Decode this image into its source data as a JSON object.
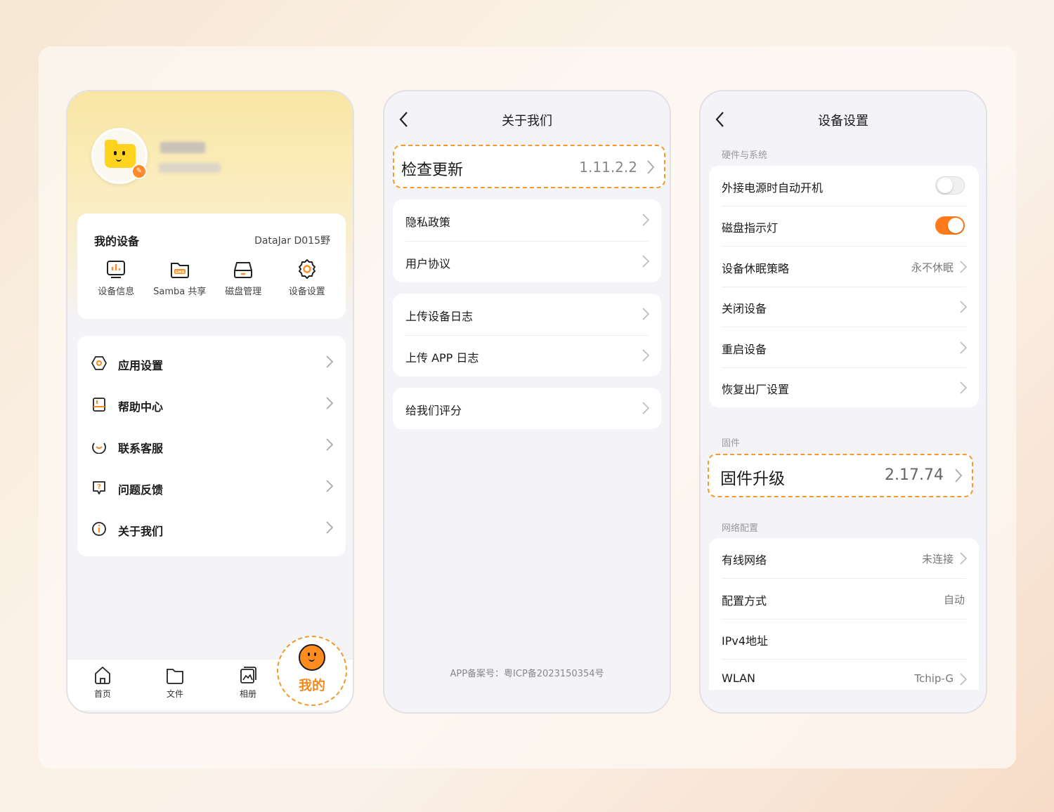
{
  "colors": {
    "accent": "#ff7a1a",
    "highlight_border": "#f39a2b",
    "background": "#fbf1e6"
  },
  "phone1": {
    "device_panel": {
      "title": "我的设备",
      "device_name": "DataJar D015野",
      "tools": [
        {
          "label": "设备信息",
          "icon": "chart-icon"
        },
        {
          "label": "Samba 共享",
          "icon": "smb-folder-icon"
        },
        {
          "label": "磁盘管理",
          "icon": "disk-icon"
        },
        {
          "label": "设备设置",
          "icon": "gear-icon"
        }
      ]
    },
    "menu": [
      {
        "label": "应用设置",
        "icon": "app-settings-icon"
      },
      {
        "label": "帮助中心",
        "icon": "help-book-icon"
      },
      {
        "label": "联系客服",
        "icon": "customer-service-icon"
      },
      {
        "label": "问题反馈",
        "icon": "feedback-icon"
      },
      {
        "label": "关于我们",
        "icon": "info-icon"
      }
    ],
    "tabs": [
      {
        "label": "首页",
        "icon": "home-icon"
      },
      {
        "label": "文件",
        "icon": "file-icon"
      },
      {
        "label": "相册",
        "icon": "album-icon"
      },
      {
        "label": "我的",
        "icon": "me-face-icon"
      }
    ]
  },
  "phone2": {
    "title": "关于我们",
    "check_update": {
      "label": "检查更新",
      "version": "1.11.2.2"
    },
    "group1": [
      {
        "label": "隐私政策"
      },
      {
        "label": "用户协议"
      }
    ],
    "group2": [
      {
        "label": "上传设备日志"
      },
      {
        "label": "上传 APP 日志"
      }
    ],
    "group3": [
      {
        "label": "给我们评分"
      }
    ],
    "footer": "APP备案号：粤ICP备2023150354号"
  },
  "phone3": {
    "title": "设备设置",
    "section_hw": "硬件与系统",
    "hw_rows": [
      {
        "label": "外接电源时自动开机",
        "toggle": "off"
      },
      {
        "label": "磁盘指示灯",
        "toggle": "on"
      },
      {
        "label": "设备休眠策略",
        "value": "永不休眠"
      },
      {
        "label": "关闭设备"
      },
      {
        "label": "重启设备"
      },
      {
        "label": "恢复出厂设置"
      }
    ],
    "section_fw": "固件",
    "firmware": {
      "label": "固件升级",
      "version": "2.17.74"
    },
    "section_net": "网络配置",
    "net_rows": [
      {
        "label": "有线网络",
        "value": "未连接"
      },
      {
        "label": "配置方式",
        "value": "自动"
      },
      {
        "label": "IPv4地址",
        "value": ""
      },
      {
        "label": "WLAN",
        "value": "Tchip-G"
      }
    ]
  }
}
